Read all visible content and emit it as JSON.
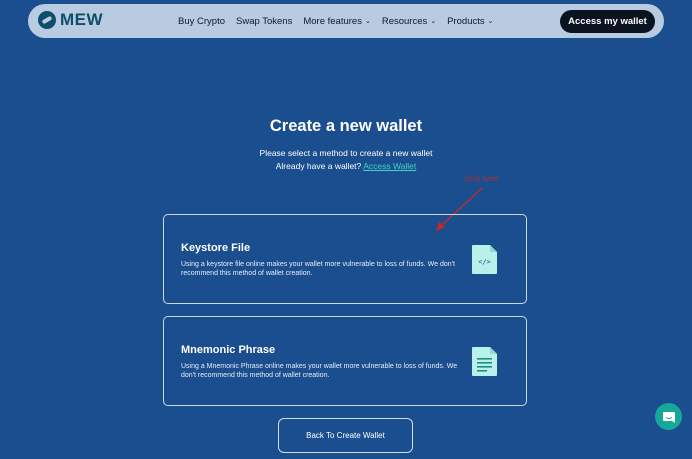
{
  "nav": {
    "logo_text": "MEW",
    "links": [
      {
        "label": "Buy Crypto",
        "has_chevron": false
      },
      {
        "label": "Swap Tokens",
        "has_chevron": false
      },
      {
        "label": "More features",
        "has_chevron": true
      },
      {
        "label": "Resources",
        "has_chevron": true
      },
      {
        "label": "Products",
        "has_chevron": true
      }
    ],
    "access_button": "Access my wallet"
  },
  "main": {
    "title": "Create a new wallet",
    "subtitle": "Please select a method to create a new wallet",
    "already_text": "Already have a wallet?",
    "access_link": "Access Wallet",
    "annotation": "click here",
    "options": [
      {
        "title": "Keystore File",
        "description": "Using a keystore file online makes your wallet more vulnerable to loss of funds. We don't recommend this method of wallet creation.",
        "icon": "code-file-icon"
      },
      {
        "title": "Mnemonic Phrase",
        "description": "Using a Mnemonic Phrase online makes your wallet more vulnerable to loss of funds. We don't recommend this method of wallet creation.",
        "icon": "text-document-icon"
      }
    ],
    "back_button": "Back To Create Wallet"
  },
  "colors": {
    "background": "#1a4e8f",
    "nav_bg": "#b8cbe0",
    "accent": "#3fd6c4",
    "icon_teal": "#b9f0ea",
    "chat_button": "#18a89a",
    "annotation": "#c62828"
  }
}
